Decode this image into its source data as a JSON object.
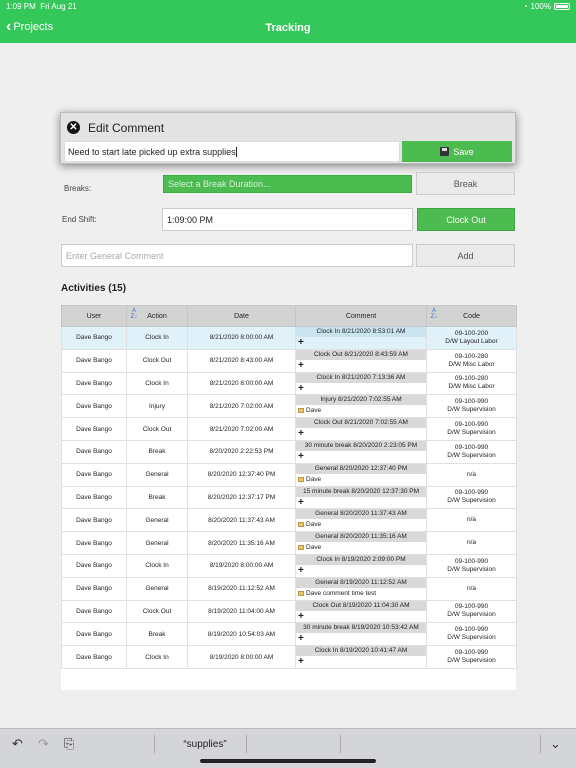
{
  "status": {
    "time": "1:09 PM",
    "date": "Fri Aug 21",
    "battery": "100%"
  },
  "nav": {
    "back_label": "Projects",
    "title": "Tracking"
  },
  "dialog": {
    "title": "Edit Comment",
    "comment_value": "Need to start late picked up extra supplies",
    "save_label": "Save"
  },
  "breaks": {
    "label": "Breaks:",
    "placeholder": "Select a Break Duration...",
    "button": "Break"
  },
  "end_shift": {
    "label": "End Shift:",
    "value": "1:09:00 PM",
    "button": "Clock Out"
  },
  "general": {
    "placeholder": "Enter General Comment",
    "button": "Add"
  },
  "activities": {
    "title": "Activities (15)",
    "columns": [
      "User",
      "Action",
      "Date",
      "Comment",
      "Code"
    ],
    "rows": [
      {
        "user": "Dave Bango",
        "action": "Clock In",
        "date": "8/21/2020 8:00:00 AM",
        "comment": "Clock In 8/21/2020 8:53:01 AM",
        "sub": "",
        "code1": "09-100-200",
        "code2": "D/W Layout Labor"
      },
      {
        "user": "Dave Bango",
        "action": "Clock Out",
        "date": "8/21/2020 8:43:00 AM",
        "comment": "Clock Out 8/21/2020 8:43:59 AM",
        "sub": "",
        "code1": "09-100-280",
        "code2": "D/W Misc Labor"
      },
      {
        "user": "Dave Bango",
        "action": "Clock In",
        "date": "8/21/2020 8:00:00 AM",
        "comment": "Clock In 8/21/2020 7:13:36 AM",
        "sub": "",
        "code1": "09-100-280",
        "code2": "D/W Misc Labor"
      },
      {
        "user": "Dave Bango",
        "action": "Injury",
        "date": "8/21/2020 7:02:00 AM",
        "comment": "Injury 8/21/2020 7:02:55 AM",
        "sub": "Dave",
        "code1": "09-100-990",
        "code2": "D/W Supervision"
      },
      {
        "user": "Dave Bango",
        "action": "Clock Out",
        "date": "8/21/2020 7:02:00 AM",
        "comment": "Clock Out 8/21/2020 7:02:55 AM",
        "sub": "",
        "code1": "09-100-990",
        "code2": "D/W Supervision"
      },
      {
        "user": "Dave Bango",
        "action": "Break",
        "date": "8/20/2020 2:22:53 PM",
        "comment": "30 minute break 8/20/2020 2:23:05 PM",
        "sub": "",
        "code1": "09-100-990",
        "code2": "D/W Supervision"
      },
      {
        "user": "Dave Bango",
        "action": "General",
        "date": "8/20/2020 12:37:40 PM",
        "comment": "General 8/20/2020 12:37:40 PM",
        "sub": "Dave",
        "code1": "n/a",
        "code2": ""
      },
      {
        "user": "Dave Bango",
        "action": "Break",
        "date": "8/20/2020 12:37:17 PM",
        "comment": "15 minute break 8/20/2020 12:37:30 PM",
        "sub": "",
        "code1": "09-100-990",
        "code2": "D/W Supervision"
      },
      {
        "user": "Dave Bango",
        "action": "General",
        "date": "8/20/2020 11:37:43 AM",
        "comment": "General 8/20/2020 11:37:43 AM",
        "sub": "Dave",
        "code1": "n/a",
        "code2": ""
      },
      {
        "user": "Dave Bango",
        "action": "General",
        "date": "8/20/2020 11:35:16 AM",
        "comment": "General 8/20/2020 11:35:16 AM",
        "sub": "Dave",
        "code1": "n/a",
        "code2": ""
      },
      {
        "user": "Dave Bango",
        "action": "Clock In",
        "date": "8/19/2020 8:00:00 AM",
        "comment": "Clock In 8/19/2020 2:09:00 PM",
        "sub": "",
        "code1": "09-100-990",
        "code2": "D/W Supervision"
      },
      {
        "user": "Dave Bango",
        "action": "General",
        "date": "8/19/2020 11:12:52 AM",
        "comment": "General 8/19/2020 11:12:52 AM",
        "sub": "Dave comment time test",
        "code1": "n/a",
        "code2": ""
      },
      {
        "user": "Dave Bango",
        "action": "Clock Out",
        "date": "8/19/2020 11:04:00 AM",
        "comment": "Clock Out 8/19/2020 11:04:30 AM",
        "sub": "",
        "code1": "09-100-990",
        "code2": "D/W Supervision"
      },
      {
        "user": "Dave Bango",
        "action": "Break",
        "date": "8/19/2020 10:54:03 AM",
        "comment": "30 minute break 8/19/2020 10:53:42 AM",
        "sub": "",
        "code1": "09-100-990",
        "code2": "D/W Supervision"
      },
      {
        "user": "Dave Bango",
        "action": "Clock In",
        "date": "8/19/2020 8:00:00 AM",
        "comment": "Clock In 8/19/2020 10:41:47 AM",
        "sub": "",
        "code1": "09-100-990",
        "code2": "D/W Supervision"
      }
    ]
  },
  "keyboard": {
    "suggestion": "“supplies”"
  },
  "colors": {
    "accent": "#34c759",
    "button_green": "#4cbb50",
    "selected_row": "#e1f1f9"
  }
}
